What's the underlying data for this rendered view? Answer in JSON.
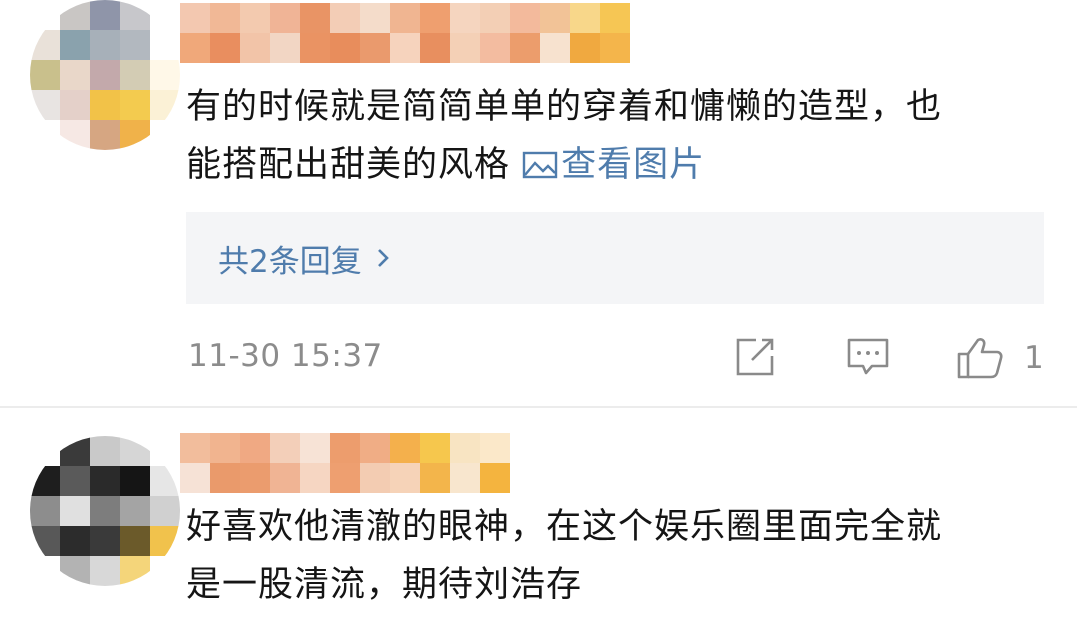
{
  "comments": [
    {
      "text_line1": "有的时候就是简简单单的穿着和慵懒的造型，也",
      "text_line2_main": "能搭配出甜美的风格 ",
      "view_image_label": "查看图片",
      "replies_label": "共2条回复",
      "timestamp": "11-30 15:37",
      "like_count": "1",
      "icons": [
        "share-icon",
        "comment-icon",
        "thumbs-up-icon",
        "image-icon",
        "chevron-right-icon"
      ]
    },
    {
      "text_line1": "好喜欢他清澈的眼神，在这个娱乐圈里面完全就",
      "text_line2": "是一股清流，期待刘浩存"
    }
  ],
  "colors": {
    "link": "#4f7cac",
    "meta_gray": "#8c8c8c",
    "reply_bg": "#f4f5f7"
  }
}
